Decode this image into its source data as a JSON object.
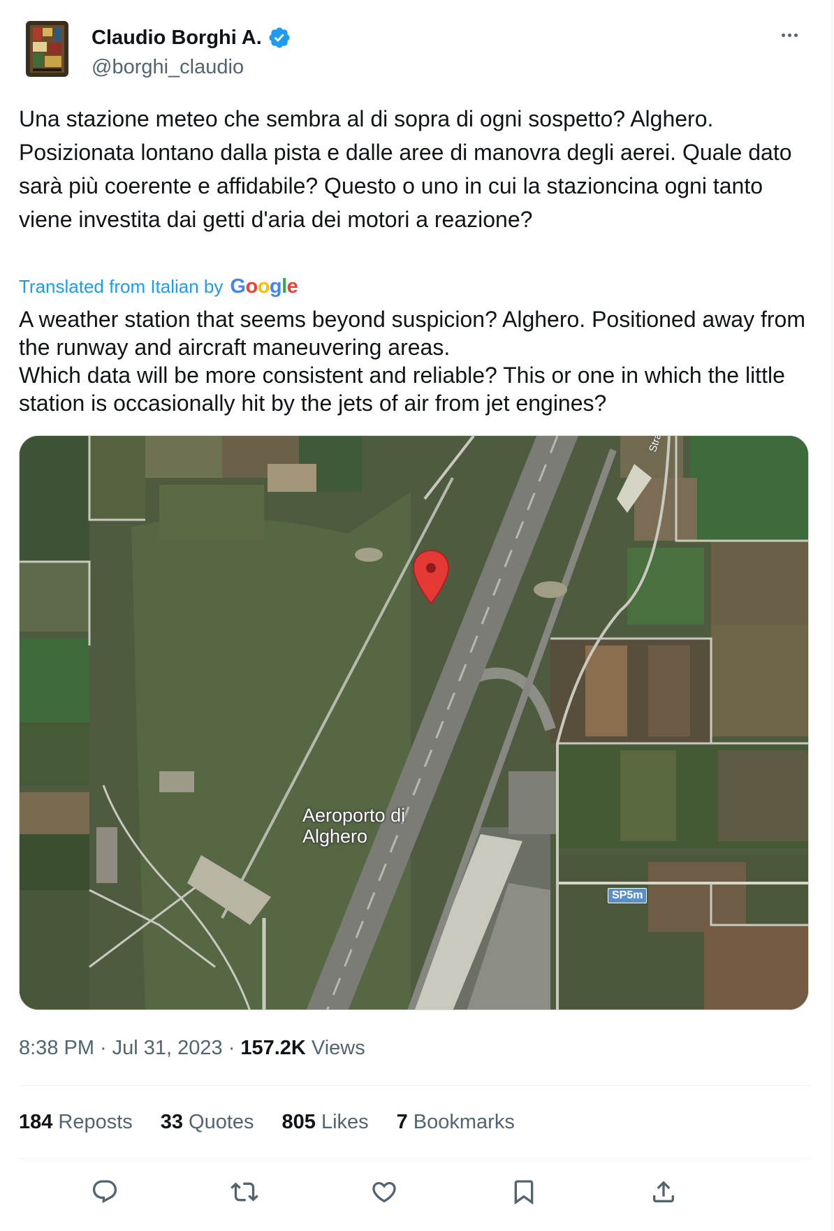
{
  "author": {
    "display_name": "Claudio Borghi A.",
    "handle": "@borghi_claudio",
    "verified": true,
    "verified_color": "#1d9bf0"
  },
  "tweet": {
    "original_text": "Una stazione meteo che sembra al di sopra di ogni sospetto? Alghero. Posizionata lontano dalla pista e dalle aree di manovra degli aerei. Quale dato sarà più coerente e affidabile? Questo o uno in cui la stazioncina ogni tanto viene investita dai getti d'aria dei motori a reazione?",
    "translated_label": "Translated from Italian by",
    "translation_provider": "Google",
    "translated_text": "A weather station that seems beyond suspicion? Alghero. Positioned away from the runway and aircraft maneuvering areas.\nWhich data will be more consistent and reliable? This or one in which the little station is occasionally hit by the jets of air from jet engines?"
  },
  "media": {
    "map_label": "Aeroporto di Alghero",
    "road_label": "SP5m",
    "street_label": "Strada",
    "pin_color": "#e53935"
  },
  "meta": {
    "time": "8:38 PM",
    "date": "Jul 31, 2023",
    "views_count": "157.2K",
    "views_label": "Views"
  },
  "stats": {
    "reposts_count": "184",
    "reposts_label": "Reposts",
    "quotes_count": "33",
    "quotes_label": "Quotes",
    "likes_count": "805",
    "likes_label": "Likes",
    "bookmarks_count": "7",
    "bookmarks_label": "Bookmarks"
  },
  "actions": [
    "reply-icon",
    "repost-icon",
    "like-icon",
    "bookmark-icon",
    "share-icon"
  ],
  "colors": {
    "text_primary": "#0f1419",
    "text_secondary": "#536471",
    "link": "#1d9bf0"
  }
}
